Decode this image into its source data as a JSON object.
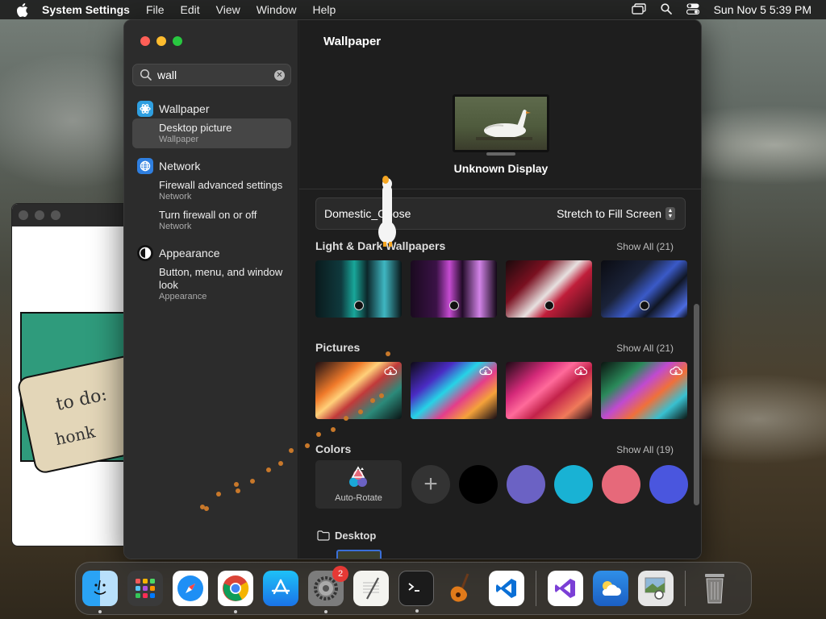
{
  "menubar": {
    "app_name": "System Settings",
    "menus": [
      "File",
      "Edit",
      "View",
      "Window",
      "Help"
    ],
    "clock": "Sun Nov 5  5:39 PM"
  },
  "background_window": {
    "note_line1": "to do:",
    "note_line2": "honk"
  },
  "sidebar": {
    "search": {
      "value": "wall"
    },
    "results": [
      {
        "category": "Wallpaper",
        "icon": "wallpaper-icon",
        "items": [
          {
            "title": "Desktop picture",
            "location": "Wallpaper",
            "selected": true
          }
        ]
      },
      {
        "category": "Network",
        "icon": "globe-icon",
        "items": [
          {
            "title": "Firewall advanced settings",
            "location": "Network"
          },
          {
            "title": "Turn firewall on or off",
            "location": "Network"
          }
        ]
      },
      {
        "category": "Appearance",
        "icon": "appearance-icon",
        "items": [
          {
            "title": "Button, menu, and window look",
            "location": "Appearance"
          }
        ]
      }
    ]
  },
  "main": {
    "title": "Wallpaper",
    "display_name": "Unknown Display",
    "current_wallpaper": "Domestic_Goose",
    "fit_mode": "Stretch to Fill Screen",
    "sections": {
      "light_dark": {
        "title": "Light & Dark Wallpapers",
        "show_all": "Show All (21)"
      },
      "pictures": {
        "title": "Pictures",
        "show_all": "Show All (21)"
      },
      "colors": {
        "title": "Colors",
        "show_all": "Show All (19)"
      },
      "desktop": {
        "title": "Desktop"
      }
    },
    "auto_rotate_label": "Auto-Rotate",
    "color_swatches": [
      "#000000",
      "#6b62c4",
      "#19b2d4",
      "#e6697a",
      "#4a56de"
    ]
  },
  "dock": {
    "items": [
      {
        "name": "finder-icon",
        "running": true
      },
      {
        "name": "launchpad-icon",
        "running": false
      },
      {
        "name": "safari-icon",
        "running": false
      },
      {
        "name": "chrome-icon",
        "running": true
      },
      {
        "name": "app-store-icon",
        "running": false
      },
      {
        "name": "system-settings-icon",
        "running": true,
        "badge": "2"
      },
      {
        "name": "textedit-icon",
        "running": false
      },
      {
        "name": "terminal-icon",
        "running": true
      },
      {
        "name": "garageband-icon",
        "running": false
      },
      {
        "name": "vscode-icon",
        "running": false
      },
      {
        "name": "visual-studio-icon",
        "running": false
      },
      {
        "name": "weather-icon",
        "running": false
      },
      {
        "name": "preview-icon",
        "running": false
      },
      {
        "name": "trash-icon",
        "running": false
      }
    ]
  }
}
